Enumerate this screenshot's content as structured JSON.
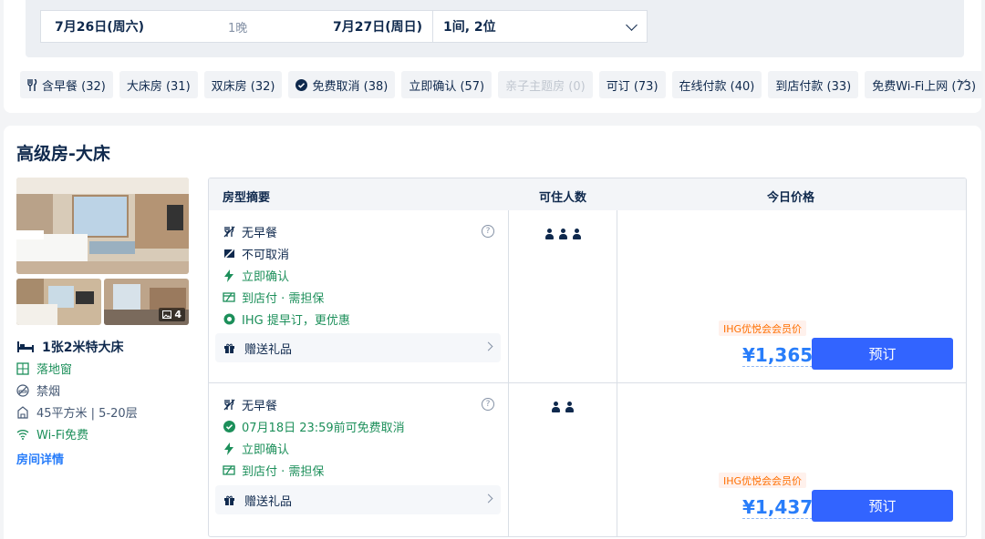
{
  "search": {
    "checkin": "7月26日(周六)",
    "nights": "1晚",
    "checkout": "7月27日(周日)",
    "guests": "1间, 2位"
  },
  "filters": [
    {
      "label": "含早餐 (32)",
      "icon": "utensils-icon",
      "disabled": false
    },
    {
      "label": "大床房 (31)",
      "disabled": false
    },
    {
      "label": "双床房 (32)",
      "disabled": false
    },
    {
      "label": "免费取消 (38)",
      "icon": "check-circle-icon",
      "disabled": false
    },
    {
      "label": "立即确认 (57)",
      "disabled": false
    },
    {
      "label": "亲子主题房 (0)",
      "disabled": true
    },
    {
      "label": "可订 (73)",
      "disabled": false
    },
    {
      "label": "在线付款 (40)",
      "disabled": false
    },
    {
      "label": "到店付款 (33)",
      "disabled": false
    },
    {
      "label": "免费Wi-Fi上网 (73)",
      "disabled": false
    }
  ],
  "room": {
    "title": "高级房-大床",
    "photo_count": "4",
    "bed": "1张2米特大床",
    "attributes": [
      {
        "text": "落地窗",
        "icon": "window-icon"
      },
      {
        "text": "禁烟",
        "icon": "no-smoking-icon"
      },
      {
        "text": "45平方米 | 5-20层",
        "icon": "area-icon"
      },
      {
        "text": "Wi-Fi免费",
        "icon": "wifi-icon"
      }
    ],
    "detail_link": "房间详情"
  },
  "table": {
    "headers": [
      "房型摘要",
      "可住人数",
      "今日价格"
    ],
    "offers": [
      {
        "features": [
          {
            "text": "无早餐",
            "icon": "no-meal-icon",
            "green": false
          },
          {
            "text": "不可取消",
            "icon": "no-cancel-icon",
            "green": false
          },
          {
            "text": "立即确认",
            "icon": "lightning-icon",
            "green": true
          },
          {
            "text": "到店付 · 需担保",
            "icon": "pay-at-hotel-icon",
            "green": true
          },
          {
            "text": "IHG 提早订，更优惠",
            "icon": "early-booking-icon",
            "green": true
          }
        ],
        "gift": "赠送礼品",
        "occupancy": 3,
        "member_tag": "IHG优悦会会员价",
        "price": "¥1,365",
        "book": "预订"
      },
      {
        "features": [
          {
            "text": "无早餐",
            "icon": "no-meal-icon",
            "green": false
          },
          {
            "text": "07月18日 23:59前可免费取消",
            "icon": "check-circle-icon",
            "green": true
          },
          {
            "text": "立即确认",
            "icon": "lightning-icon",
            "green": true
          },
          {
            "text": "到店付 · 需担保",
            "icon": "pay-at-hotel-icon",
            "green": true
          }
        ],
        "gift": "赠送礼品",
        "occupancy": 2,
        "member_tag": "IHG优悦会会员价",
        "price": "¥1,437",
        "book": "预订"
      }
    ]
  },
  "colors": {
    "accent": "#3264ff",
    "price": "#287dfa",
    "green": "#1c8f5a",
    "member": "#ff6f00"
  }
}
